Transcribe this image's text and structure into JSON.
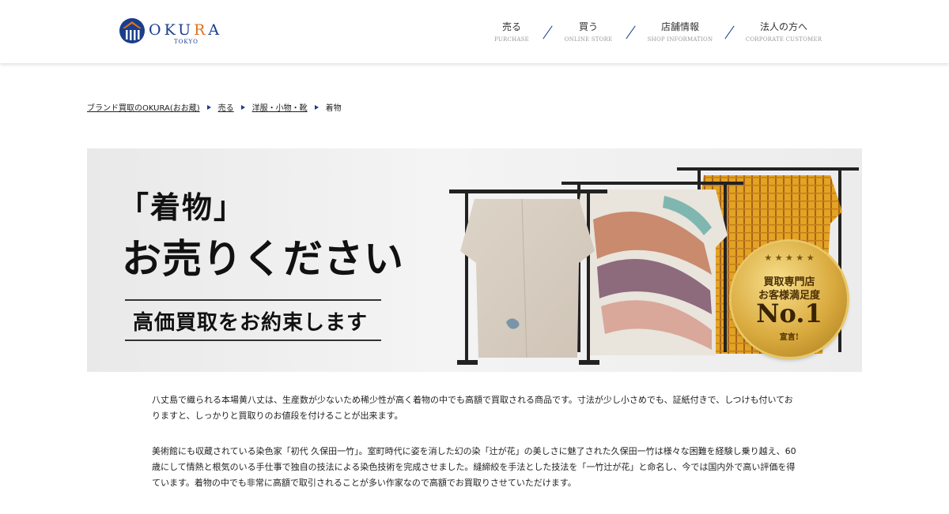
{
  "header": {
    "logo": {
      "text_before": "OKU",
      "text_accent": "R",
      "text_after": "A",
      "sub": "TOKYO"
    },
    "nav": [
      {
        "jp": "売る",
        "en": "PURCHASE"
      },
      {
        "jp": "買う",
        "en": "ONLINE STORE"
      },
      {
        "jp": "店舗情報",
        "en": "SHOP INFORMATION"
      },
      {
        "jp": "法人の方へ",
        "en": "CORPORATE CUSTOMER"
      }
    ]
  },
  "breadcrumb": [
    "ブランド買取のOKURA(おお蔵)",
    "売る",
    "洋服・小物・靴",
    "着物"
  ],
  "banner": {
    "title1": "「着物」",
    "title2": "お売りください",
    "tagline": "高価買取をお約束します",
    "badge": {
      "line1": "買取専門店",
      "line2": "お客様満足度",
      "line3": "No.1",
      "line4": "宣言!"
    }
  },
  "content": {
    "paragraph1": "八丈島で織られる本場黄八丈は、生産数が少ないため稀少性が高く着物の中でも高額で買取される商品です。寸法が少し小さめでも、証紙付きで、しつけも付いておりますと、しっかりと買取りのお値段を付けることが出来ます。",
    "paragraph2": "美術館にも収蔵されている染色家「初代 久保田一竹」。室町時代に姿を消した幻の染「辻が花」の美しさに魅了された久保田一竹は様々な困難を経験し乗り越え、60歳にして情熱と根気のいる手仕事で独自の技法による染色技術を完成させました。縫締絞を手法とした技法を「一竹辻が花」と命名し、今では国内外で高い評価を得ています。着物の中でも非常に高額で取引されることが多い作家なので高額でお買取りさせていただけます。"
  },
  "colors": {
    "brand_blue": "#1a3e8c",
    "brand_orange": "#e0701a",
    "gold": "#d9aa3e"
  }
}
